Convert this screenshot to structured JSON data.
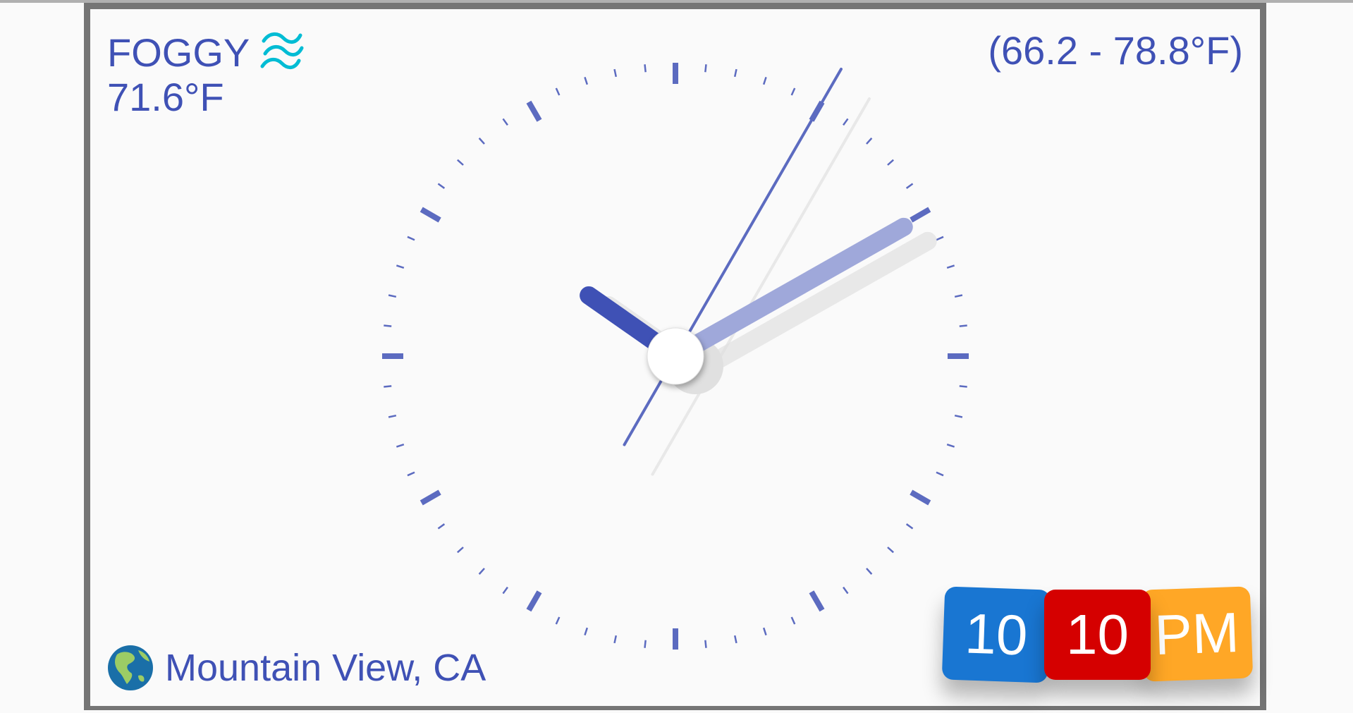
{
  "weather": {
    "condition": "FOGGY",
    "condition_icon": "fog-waves-icon",
    "temperature": "71.6°F",
    "range": "(66.2 - 78.8°F)"
  },
  "location": {
    "icon": "globe-americas-icon",
    "name": "Mountain View, CA"
  },
  "time": {
    "hour": "10",
    "minute": "10",
    "ampm": "PM",
    "second": 5
  },
  "colors": {
    "text": "#3f51b5",
    "ticks": "#5c6bc0",
    "hour_hand": "#3f51b5",
    "minute_hand": "#9fa8da",
    "second_hand": "#5c6bc0",
    "hour_tile": "#1976d2",
    "minute_tile": "#d50000",
    "ampm_tile": "#ffa726"
  }
}
